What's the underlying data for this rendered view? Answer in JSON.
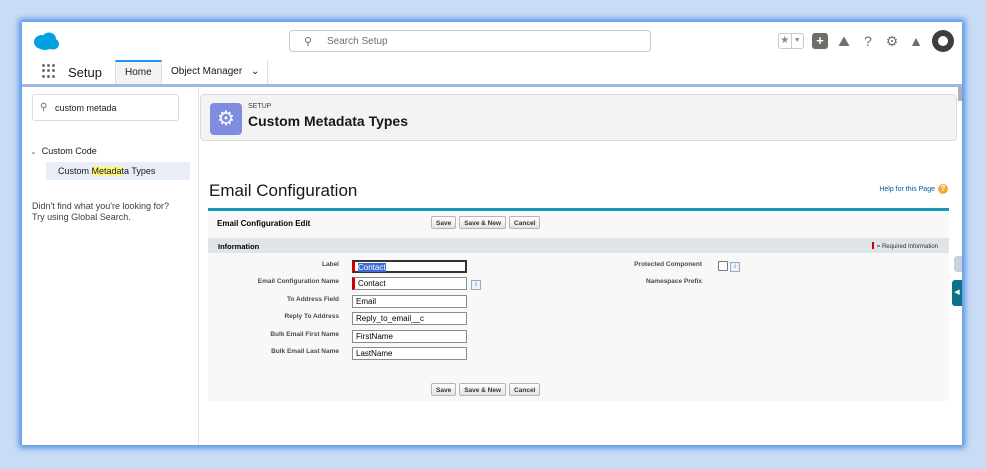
{
  "global_header": {
    "search_placeholder": "Search Setup",
    "colors": {
      "brand": "#00a1e0",
      "accent": "#1b96ff"
    },
    "icons": [
      "cloud-logo-icon",
      "search-icon",
      "star-icon",
      "dropdown-icon",
      "add-icon",
      "trailhead-icon",
      "help-icon",
      "settings-icon",
      "bell-icon",
      "avatar"
    ]
  },
  "nav": {
    "app_name": "Setup",
    "tabs": [
      {
        "label": "Home"
      },
      {
        "label": "Object Manager"
      }
    ]
  },
  "sidebar": {
    "quick_find_value": "custom metada",
    "tree_group": "Custom Code",
    "tree_item": {
      "before": "Custom ",
      "highlight": "Metada",
      "after": "ta Types"
    },
    "not_found_line1": "Didn't find what you're looking for?",
    "not_found_line2": "Try using Global Search."
  },
  "page_header": {
    "eyebrow": "SETUP",
    "title": "Custom Metadata Types"
  },
  "content": {
    "title": "Email Configuration",
    "help_link": "Help for this Page",
    "edit_block_title": "Email Configuration Edit",
    "buttons": {
      "save": "Save",
      "save_new": "Save & New",
      "cancel": "Cancel"
    },
    "section_title": "Information",
    "required_legend": "= Required Information",
    "fields": {
      "label": {
        "label": "Label",
        "value": "Contact"
      },
      "name": {
        "label": "Email Configuration Name",
        "value": "Contact"
      },
      "to": {
        "label": "To Address Field",
        "value": "Email"
      },
      "reply": {
        "label": "Reply To Address",
        "value": "Reply_to_email__c"
      },
      "first": {
        "label": "Bulk Email First Name",
        "value": "FirstName"
      },
      "last": {
        "label": "Bulk Email Last Name",
        "value": "LastName"
      },
      "protected": {
        "label": "Protected Component"
      },
      "namespace": {
        "label": "Namespace Prefix"
      }
    }
  }
}
